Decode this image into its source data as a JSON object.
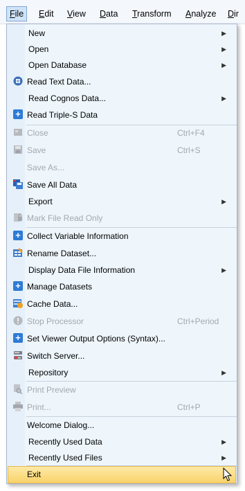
{
  "menubar": {
    "items": [
      {
        "first": "F",
        "rest": "ile"
      },
      {
        "first": "E",
        "rest": "dit"
      },
      {
        "first": "V",
        "rest": "iew"
      },
      {
        "first": "D",
        "rest": "ata"
      },
      {
        "first": "T",
        "rest": "ransform"
      },
      {
        "first": "A",
        "rest": "nalyze"
      },
      {
        "first": "D",
        "rest": "ir"
      }
    ]
  },
  "file_menu": {
    "items": [
      {
        "label": "New",
        "shortcut": "",
        "submenu": true,
        "disabled": false,
        "icon": ""
      },
      {
        "label": "Open",
        "shortcut": "",
        "submenu": true,
        "disabled": false,
        "icon": ""
      },
      {
        "label": "Open Database",
        "shortcut": "",
        "submenu": true,
        "disabled": false,
        "icon": ""
      },
      {
        "label": "Read Text Data...",
        "shortcut": "",
        "submenu": false,
        "disabled": false,
        "icon": "read-text-icon"
      },
      {
        "label": "Read Cognos Data...",
        "shortcut": "",
        "submenu": true,
        "disabled": false,
        "icon": ""
      },
      {
        "label": "Read Triple-S Data",
        "shortcut": "",
        "submenu": false,
        "disabled": false,
        "icon": "plus-icon"
      },
      {
        "label": "Close",
        "shortcut": "Ctrl+F4",
        "submenu": false,
        "disabled": true,
        "icon": "close-file-icon"
      },
      {
        "label": "Save",
        "shortcut": "Ctrl+S",
        "submenu": false,
        "disabled": true,
        "icon": "save-icon"
      },
      {
        "label": "Save As...",
        "shortcut": "",
        "submenu": false,
        "disabled": true,
        "icon": ""
      },
      {
        "label": "Save All Data",
        "shortcut": "",
        "submenu": false,
        "disabled": false,
        "icon": "save-all-icon"
      },
      {
        "label": "Export",
        "shortcut": "",
        "submenu": true,
        "disabled": false,
        "icon": ""
      },
      {
        "label": "Mark File Read Only",
        "shortcut": "",
        "submenu": false,
        "disabled": true,
        "icon": "lock-icon"
      },
      {
        "label": "Collect Variable Information",
        "shortcut": "",
        "submenu": false,
        "disabled": false,
        "icon": "plus-icon"
      },
      {
        "label": "Rename Dataset...",
        "shortcut": "",
        "submenu": false,
        "disabled": false,
        "icon": "rename-icon"
      },
      {
        "label": "Display Data File Information",
        "shortcut": "",
        "submenu": true,
        "disabled": false,
        "icon": ""
      },
      {
        "label": "Manage Datasets",
        "shortcut": "",
        "submenu": false,
        "disabled": false,
        "icon": "plus-icon"
      },
      {
        "label": "Cache Data...",
        "shortcut": "",
        "submenu": false,
        "disabled": false,
        "icon": "cache-icon"
      },
      {
        "label": "Stop Processor",
        "shortcut": "Ctrl+Period",
        "submenu": false,
        "disabled": true,
        "icon": "stop-icon"
      },
      {
        "label": "Set Viewer Output Options (Syntax)...",
        "shortcut": "",
        "submenu": false,
        "disabled": false,
        "icon": "plus-icon"
      },
      {
        "label": "Switch Server...",
        "shortcut": "",
        "submenu": false,
        "disabled": false,
        "icon": "server-icon"
      },
      {
        "label": "Repository",
        "shortcut": "",
        "submenu": true,
        "disabled": false,
        "icon": ""
      },
      {
        "label": "Print Preview",
        "shortcut": "",
        "submenu": false,
        "disabled": true,
        "icon": "print-preview-icon"
      },
      {
        "label": "Print...",
        "shortcut": "Ctrl+P",
        "submenu": false,
        "disabled": true,
        "icon": "print-icon"
      },
      {
        "label": "Welcome Dialog...",
        "shortcut": "",
        "submenu": false,
        "disabled": false,
        "icon": ""
      },
      {
        "label": "Recently Used Data",
        "shortcut": "",
        "submenu": true,
        "disabled": false,
        "icon": ""
      },
      {
        "label": "Recently Used Files",
        "shortcut": "",
        "submenu": true,
        "disabled": false,
        "icon": ""
      },
      {
        "label": "Exit",
        "shortcut": "",
        "submenu": false,
        "disabled": false,
        "icon": "",
        "highlighted": true
      }
    ]
  },
  "colors": {
    "plus_icon": "#2d7bd5",
    "disabled_text": "#a3a8b0",
    "highlight": "#f9d36b"
  }
}
